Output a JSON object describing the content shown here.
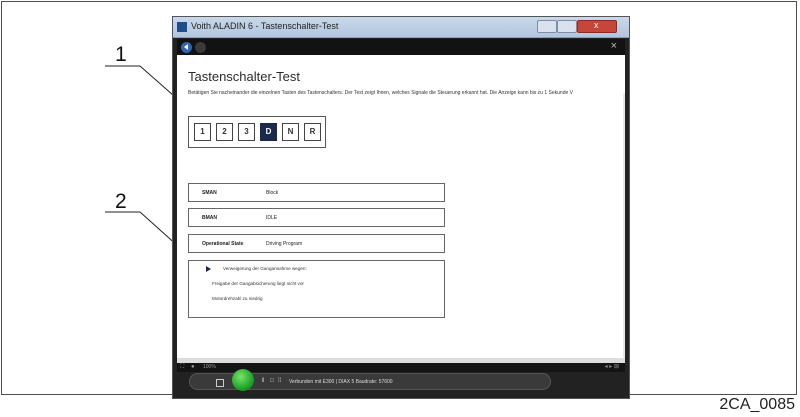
{
  "callouts": [
    "1",
    "2"
  ],
  "figure_code": "2CA_0085",
  "window": {
    "title": "Voith ALADIN 6 - Tastenschalter-Test",
    "close_glyph": "x"
  },
  "nav": {
    "close_glyph": "×"
  },
  "page": {
    "title": "Tastenschalter-Test",
    "instruction": "Betätigen Sie nacheinander die einzelnen Tasten des Tastenschalters. Der Test zeigt Ihnen, welches Signale die Steuerung erkannt hat. Die Anzeige kann bis zu 1 Sekunde V"
  },
  "keys": [
    {
      "label": "1",
      "active": false
    },
    {
      "label": "2",
      "active": false
    },
    {
      "label": "3",
      "active": false
    },
    {
      "label": "D",
      "active": true
    },
    {
      "label": "N",
      "active": false
    },
    {
      "label": "R",
      "active": false
    }
  ],
  "signals": [
    {
      "label": "SMAN",
      "value": "Block"
    },
    {
      "label": "BMAN",
      "value": "IDLE"
    },
    {
      "label": "Operational State",
      "value": "Driving Program"
    }
  ],
  "messages": [
    "Verweigerung der Gangannahme wegen:",
    "Freigabe der Gangabsicherung liegt nicht vor",
    "Motordrehzahl zu niedrig"
  ],
  "status": {
    "zoom": "100%",
    "connection": "Verbunden mit E300 | DIAX 5 Baudrate: 57600",
    "right_glyphs": "◂ ▸ ⊠"
  },
  "colors": {
    "active_key": "#1b2a4a",
    "status_ball": "#1fa52a"
  }
}
